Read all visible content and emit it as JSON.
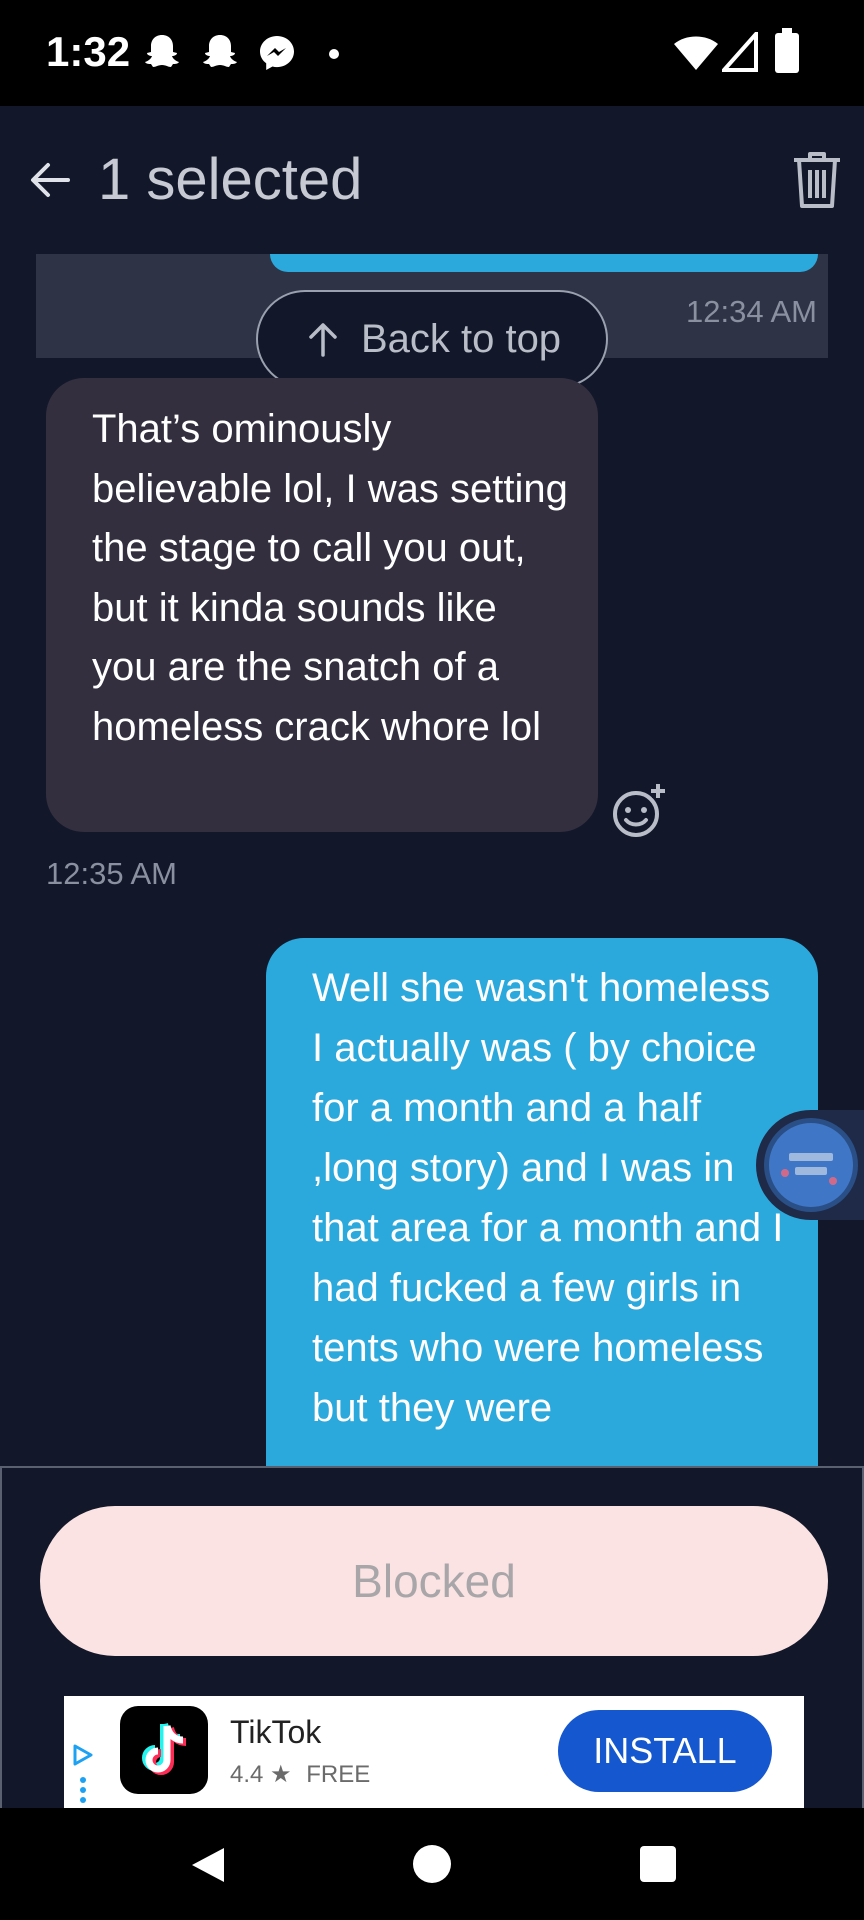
{
  "status_bar": {
    "time": "1:32",
    "notification_icons": [
      "snapchat-icon",
      "snapchat-icon",
      "messenger-icon",
      "dot-icon"
    ],
    "system_icons": [
      "wifi-icon",
      "cell-signal-icon",
      "battery-icon"
    ]
  },
  "app_bar": {
    "title": "1 selected",
    "back_icon": "arrow-left-icon",
    "delete_icon": "trash-icon"
  },
  "conversation": {
    "selected_message_time": "12:34 AM",
    "back_to_top_label": "Back to top",
    "received_message": {
      "text": "That’s ominously believable lol, I was setting the stage to call you out, but it kinda sounds like you are the snatch of a homeless crack whore lol",
      "time": "12:35 AM"
    },
    "sent_message": {
      "text": "Well she wasn't homeless I actually was ( by choice for a month and a half ,long story) and I was in that area for a month and I had fucked a few girls in tents who were homeless but they were"
    }
  },
  "composer": {
    "blocked_label": "Blocked"
  },
  "ad": {
    "app_name": "TikTok",
    "rating": "4.4",
    "star": "★",
    "price": "FREE",
    "install_label": "INSTALL"
  },
  "colors": {
    "background": "#12182a",
    "sent_bubble": "#2ca9dc",
    "received_bubble": "#332f3f",
    "blocked_pill": "#fbe3e3",
    "install_button": "#1557cf"
  }
}
